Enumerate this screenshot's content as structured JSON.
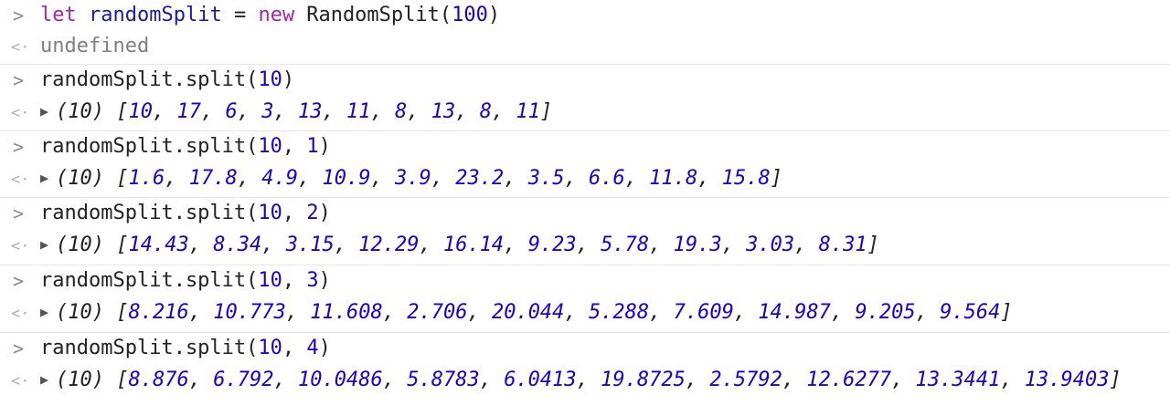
{
  "console": {
    "prompt_icon": ">",
    "result_icon": "<·",
    "expand_icon": "▶",
    "entries": [
      {
        "input": {
          "keyword_let": "let",
          "var_name": "randomSplit",
          "equals": "=",
          "keyword_new": "new",
          "class_name": "RandomSplit(",
          "arg": "100",
          "close": ")"
        },
        "output": {
          "text": "undefined"
        }
      },
      {
        "input": {
          "call": "randomSplit.split(",
          "args": [
            "10"
          ],
          "close": ")"
        },
        "output": {
          "count": "(10)",
          "values": [
            "10",
            "17",
            "6",
            "3",
            "13",
            "11",
            "8",
            "13",
            "8",
            "11"
          ]
        }
      },
      {
        "input": {
          "call": "randomSplit.split(",
          "args": [
            "10",
            "1"
          ],
          "close": ")"
        },
        "output": {
          "count": "(10)",
          "values": [
            "1.6",
            "17.8",
            "4.9",
            "10.9",
            "3.9",
            "23.2",
            "3.5",
            "6.6",
            "11.8",
            "15.8"
          ]
        }
      },
      {
        "input": {
          "call": "randomSplit.split(",
          "args": [
            "10",
            "2"
          ],
          "close": ")"
        },
        "output": {
          "count": "(10)",
          "values": [
            "14.43",
            "8.34",
            "3.15",
            "12.29",
            "16.14",
            "9.23",
            "5.78",
            "19.3",
            "3.03",
            "8.31"
          ]
        }
      },
      {
        "input": {
          "call": "randomSplit.split(",
          "args": [
            "10",
            "3"
          ],
          "close": ")"
        },
        "output": {
          "count": "(10)",
          "values": [
            "8.216",
            "10.773",
            "11.608",
            "2.706",
            "20.044",
            "5.288",
            "7.609",
            "14.987",
            "9.205",
            "9.564"
          ]
        }
      },
      {
        "input": {
          "call": "randomSplit.split(",
          "args": [
            "10",
            "4"
          ],
          "close": ")"
        },
        "output": {
          "count": "(10)",
          "values": [
            "8.876",
            "6.792",
            "10.0486",
            "5.8783",
            "6.0413",
            "19.8725",
            "2.5792",
            "12.6277",
            "13.3441",
            "13.9403"
          ]
        }
      }
    ]
  },
  "colors": {
    "keyword": "#a626a4",
    "variable": "#1a1aa6",
    "number": "#1c00cf",
    "undefined": "#808080",
    "separator": "#e6e6e6"
  }
}
